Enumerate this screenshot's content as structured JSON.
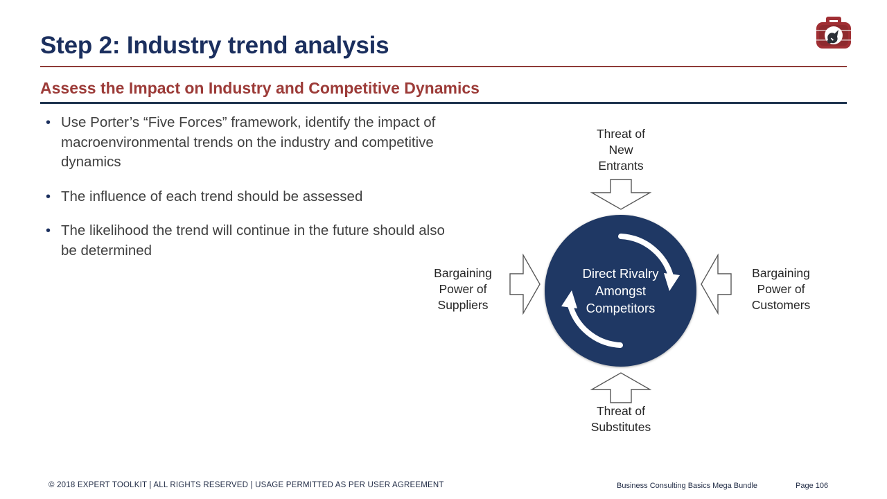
{
  "slide": {
    "title": "Step 2: Industry trend analysis",
    "subtitle": "Assess the Impact on Industry and Competitive Dynamics",
    "logo_icon": "toolbox-icon",
    "bullets": [
      "Use Porter’s “Five Forces” framework, identify the impact of macroenvironmental trends on the industry and competitive dynamics",
      "The influence of each trend should be assessed",
      "The likelihood the trend will continue in the future should also be determined"
    ],
    "diagram": {
      "center_label": "Direct Rivalry Amongst Competitors",
      "center_label_lines": [
        "Direct Rivalry",
        "Amongst",
        "Competitors"
      ],
      "top_label": "Threat of New Entrants",
      "top_label_lines": [
        "Threat of",
        "New",
        "Entrants"
      ],
      "bottom_label": "Threat of Substitutes",
      "bottom_label_lines": [
        "Threat of",
        "Substitutes"
      ],
      "left_label": "Bargaining Power of Suppliers",
      "left_label_lines": [
        "Bargaining",
        "Power of",
        "Suppliers"
      ],
      "right_label": "Bargaining Power of Customers",
      "right_label_lines": [
        "Bargaining",
        "Power of",
        "Customers"
      ],
      "arrows": {
        "top_icon": "arrow-down-icon",
        "bottom_icon": "arrow-up-icon",
        "left_icon": "arrow-right-icon",
        "right_icon": "arrow-left-icon",
        "rotation_icon": "circular-arrows-icon"
      }
    },
    "footer": {
      "copyright": "© 2018 EXPERT TOOLKIT | ALL RIGHTS RESERVED | USAGE PERMITTED AS PER USER AGREEMENT",
      "bundle": "Business Consulting Basics Mega Bundle",
      "page": "Page 106"
    },
    "colors": {
      "title_navy": "#1b2f5e",
      "subtitle_red": "#9c3b38",
      "rule_red": "#8f3b38",
      "rule_navy": "#1f3550",
      "circle_navy": "#1f3864",
      "body_text": "#404040",
      "label_text": "#262626",
      "logo_red": "#a02f34"
    }
  }
}
